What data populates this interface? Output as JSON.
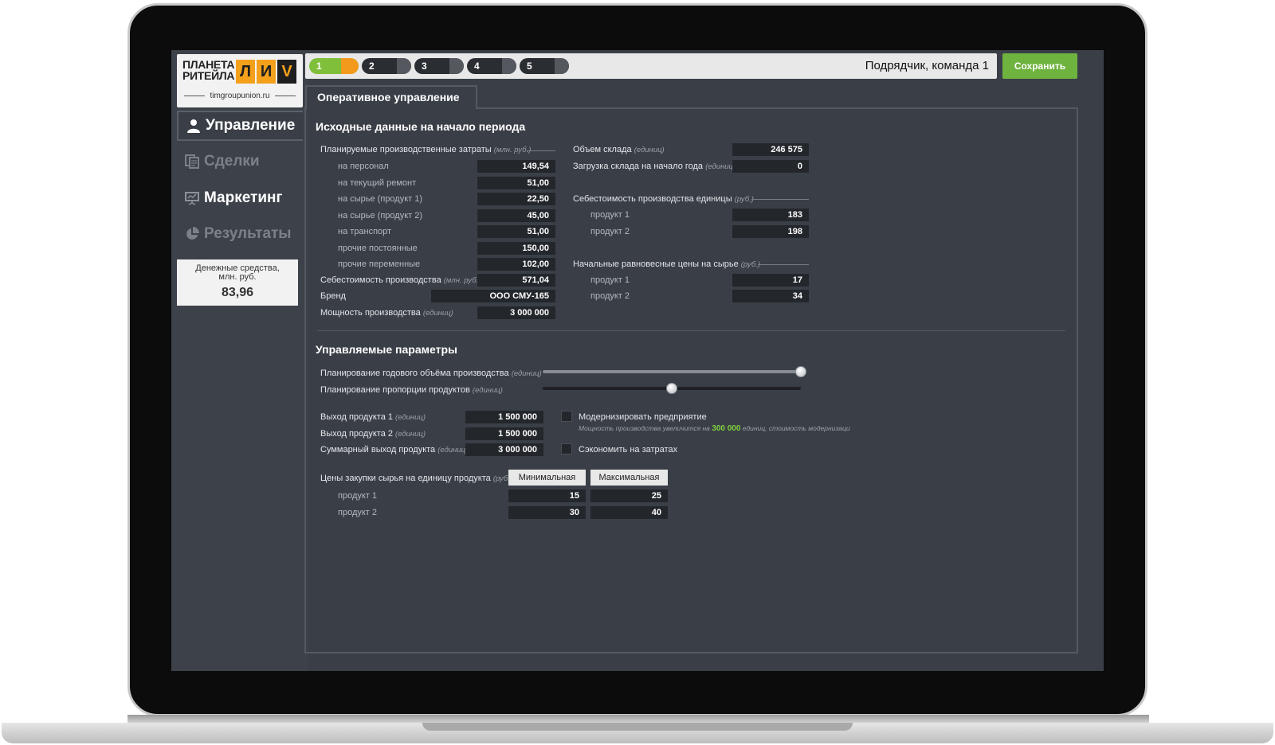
{
  "logo": {
    "line1": "ПЛАНЕТА",
    "line2": "РИТЕЙЛА",
    "marks": [
      "Л",
      "И",
      "V"
    ],
    "site": "timgroupunion.ru"
  },
  "nav": {
    "items": [
      {
        "label": "Управление",
        "icon": "user-icon"
      },
      {
        "label": "Сделки",
        "icon": "documents-icon"
      },
      {
        "label": "Маркетинг",
        "icon": "presentation-icon"
      },
      {
        "label": "Результаты",
        "icon": "pie-chart-icon"
      }
    ]
  },
  "cash": {
    "label_line1": "Денежные средства,",
    "label_line2": "млн. руб.",
    "value": "83,96"
  },
  "steps": {
    "items": [
      "1",
      "2",
      "3",
      "4",
      "5"
    ],
    "active": 1
  },
  "header": {
    "team": "Подрядчик, команда 1",
    "save": "Сохранить"
  },
  "tab": "Оперативное управление",
  "initial": {
    "title": "Исходные данные на начало периода",
    "costs_label": "Планируемые производственные затраты",
    "costs_unit": "(млн. руб.)",
    "cost_items": [
      {
        "label": "на персонал",
        "value": "149,54"
      },
      {
        "label": "на текущий ремонт",
        "value": "51,00"
      },
      {
        "label": "на сырье (продукт 1)",
        "value": "22,50"
      },
      {
        "label": "на сырье (продукт 2)",
        "value": "45,00"
      },
      {
        "label": "на транспорт",
        "value": "51,00"
      },
      {
        "label": "прочие постоянные",
        "value": "150,00"
      },
      {
        "label": "прочие переменные",
        "value": "102,00"
      }
    ],
    "cost_total_label": "Себестоимость производства",
    "cost_total_unit": "(млн. руб.)",
    "cost_total_value": "571,04",
    "brand_label": "Бренд",
    "brand_value": "ООО СМУ-165",
    "capacity_label": "Мощность производства",
    "capacity_unit": "(единиц)",
    "capacity_value": "3 000 000",
    "warehouse_label": "Объем склада",
    "warehouse_unit": "(единиц)",
    "warehouse_value": "246 575",
    "load_label": "Загрузка склада на начало года",
    "load_unit": "(единиц)",
    "load_value": "0",
    "unit_cost_label": "Себестоимость производства единицы",
    "unit_cost_unit": "(руб.)",
    "unit_cost_items": [
      {
        "label": "продукт 1",
        "value": "183"
      },
      {
        "label": "продукт 2",
        "value": "198"
      }
    ],
    "eq_prices_label": "Начальные равновесные цены на сырье",
    "eq_prices_unit": "(руб.)",
    "eq_prices_items": [
      {
        "label": "продукт 1",
        "value": "17"
      },
      {
        "label": "продукт 2",
        "value": "34"
      }
    ]
  },
  "controls": {
    "title": "Управляемые параметры",
    "annual_label": "Планирование годового объёма производства",
    "annual_unit": "(единиц)",
    "annual_level": 1.0,
    "proportion_label": "Планирование пропорции продуктов",
    "proportion_unit": "(единиц)",
    "proportion_level": 0.5,
    "outputs": [
      {
        "label": "Выход продукта 1",
        "unit": "(единиц)",
        "value": "1 500 000"
      },
      {
        "label": "Выход продукта 2",
        "unit": "(единиц)",
        "value": "1 500 000"
      },
      {
        "label": "Суммарный выход продукта",
        "unit": "(единиц)",
        "value": "3 000 000"
      }
    ],
    "modernize_label": "Модернизировать предприятие",
    "modernize_note_pre": "Мощность производства увеличится на",
    "modernize_note_value": "300 000",
    "modernize_note_post": "единиц, стоимость модернизаци",
    "save_costs_label": "Сэкономить на затратах",
    "prices_label": "Цены закупки сырья на единицу продукта",
    "prices_unit": "(руб.)",
    "prices_headers": [
      "Минимальная",
      "Максимальная"
    ],
    "prices_rows": [
      {
        "label": "продукт 1",
        "min": "15",
        "max": "25"
      },
      {
        "label": "продукт 2",
        "min": "30",
        "max": "40"
      }
    ]
  },
  "colors": {
    "accent_green": "#6fb33f",
    "accent_orange": "#f39a1c",
    "highlight_green": "#7fd03c",
    "panel_bg": "#3a3f47"
  }
}
